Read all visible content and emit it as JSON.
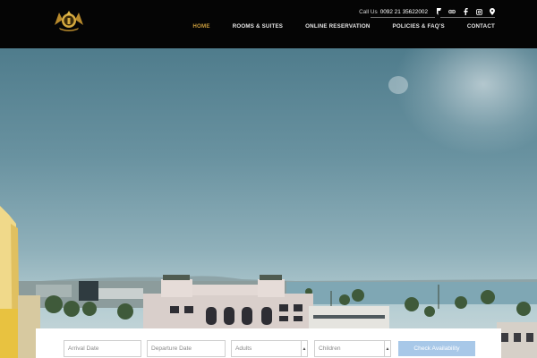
{
  "header": {
    "logo_icon": "crest-logo-icon",
    "call_label": "Call Us",
    "phone": "0092 21 35622002",
    "social_icons": [
      "foursquare-icon",
      "tripadvisor-icon",
      "facebook-icon",
      "instagram-icon",
      "map-pin-icon"
    ],
    "nav": [
      {
        "label": "HOME",
        "active": true
      },
      {
        "label": "ROOMS & SUITES",
        "active": false
      },
      {
        "label": "ONLINE RESERVATION",
        "active": false
      },
      {
        "label": "POLICIES & FAQ'S",
        "active": false
      },
      {
        "label": "CONTACT",
        "active": false
      }
    ],
    "accent_color": "#c89b3c"
  },
  "booking": {
    "arrival_placeholder": "Arrival Date",
    "departure_placeholder": "Departure Date",
    "adults_label": "Adults",
    "children_label": "Children",
    "check_button": "Check Availability",
    "button_color": "#a8c8e8"
  }
}
